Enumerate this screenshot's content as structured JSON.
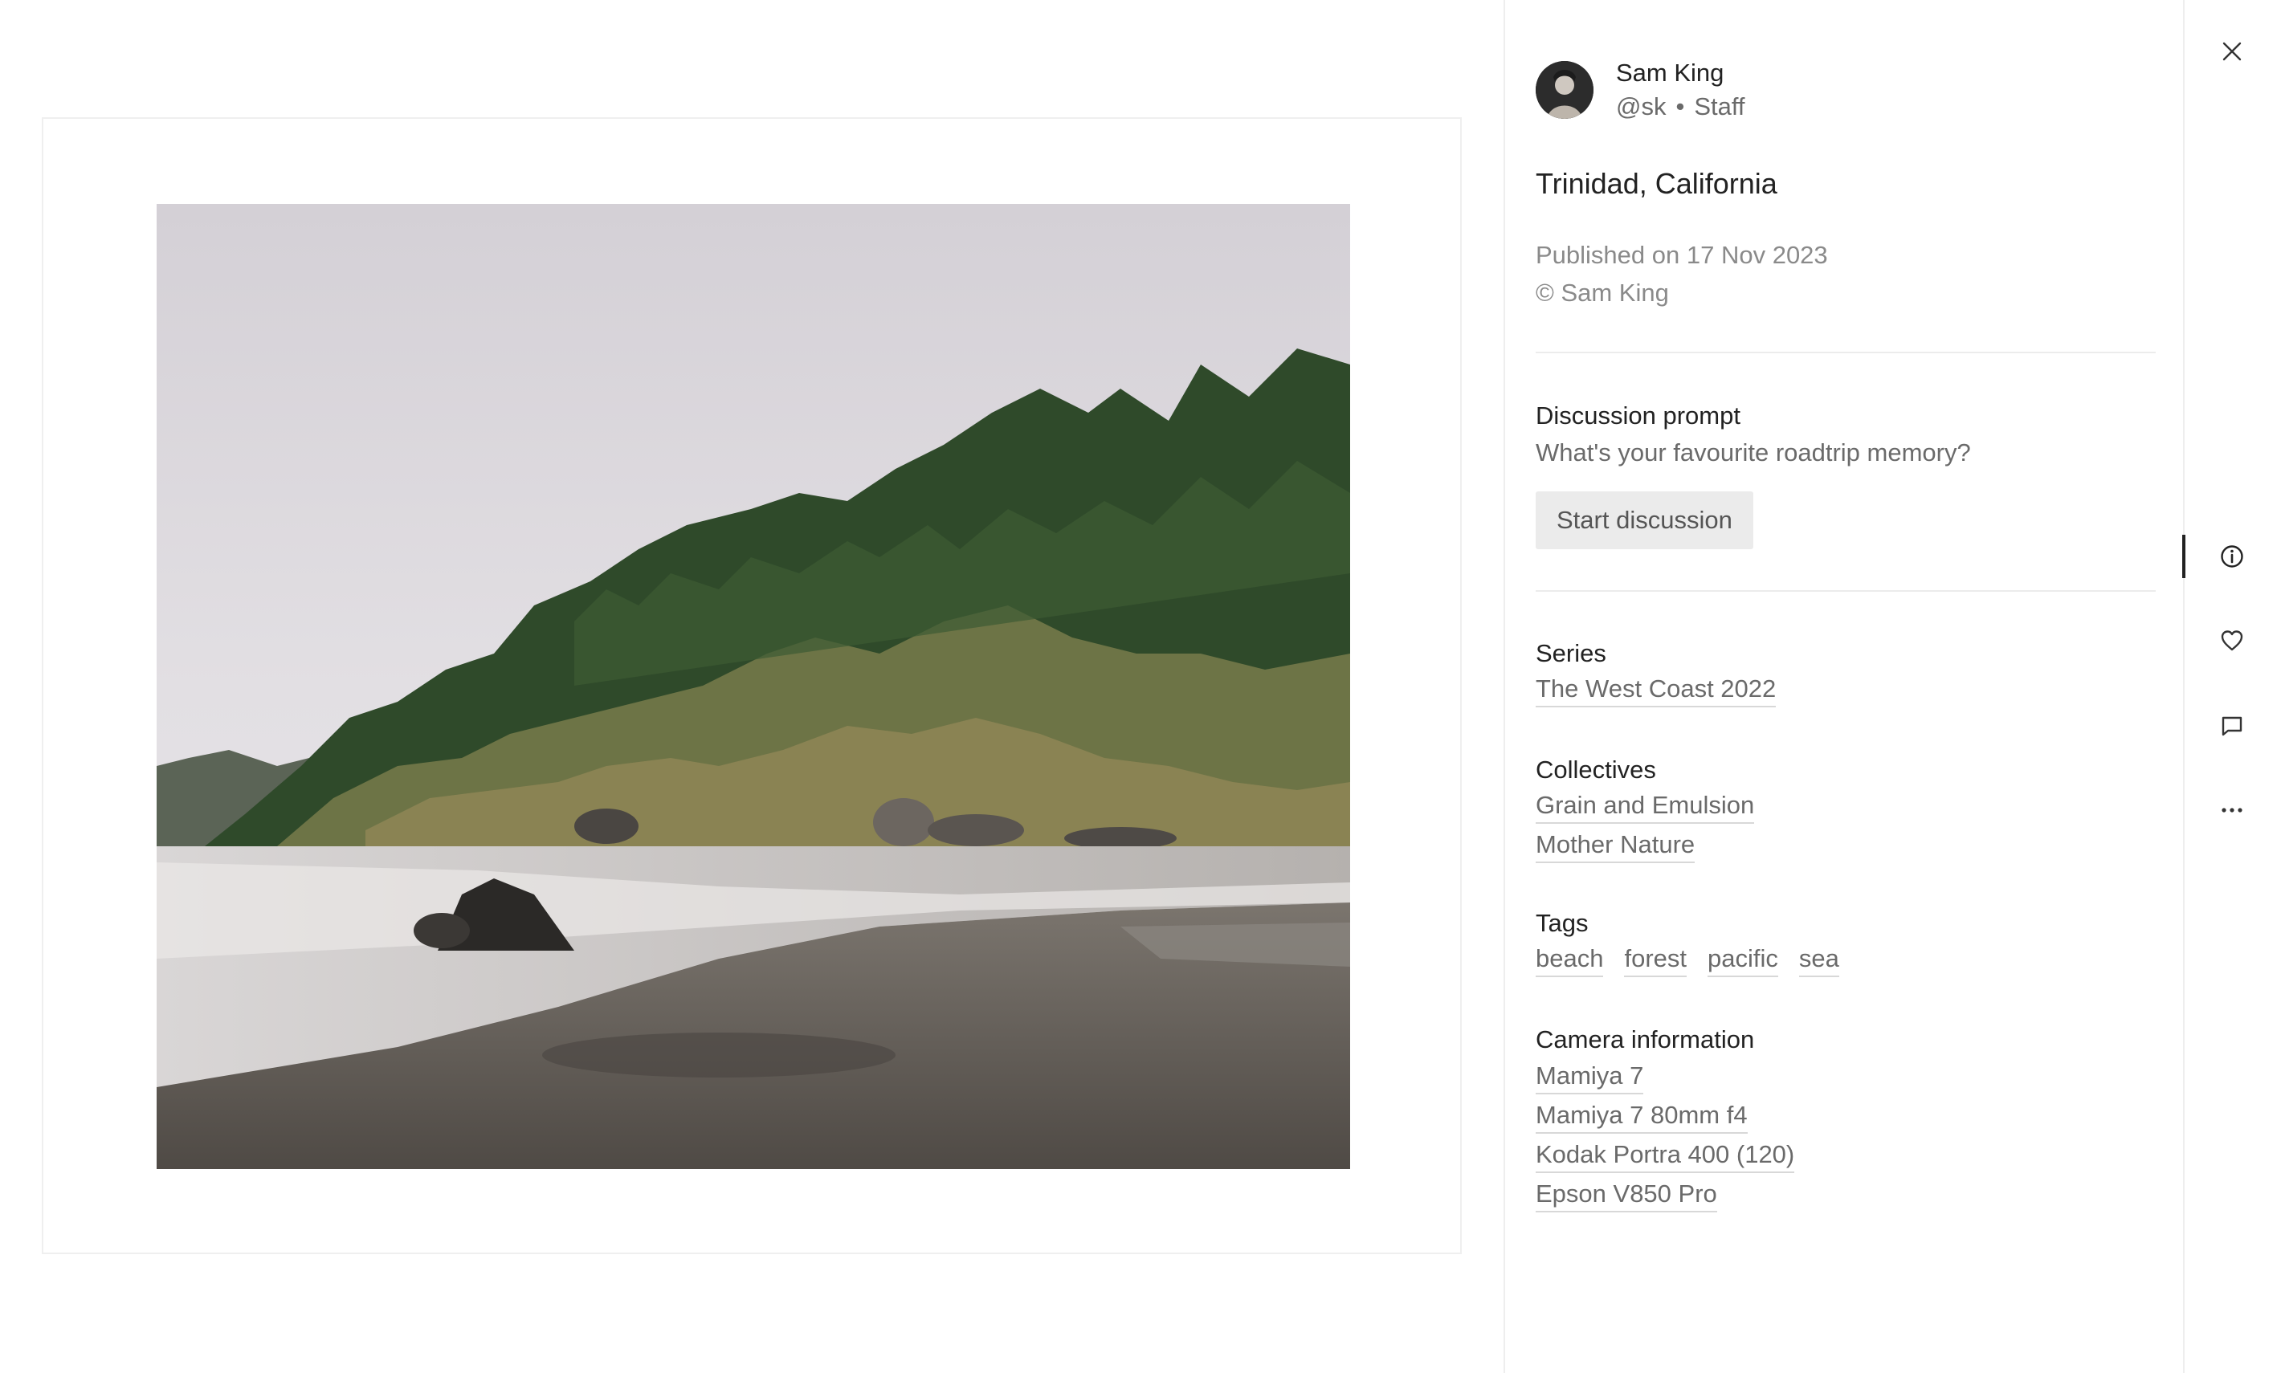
{
  "author": {
    "name": "Sam King",
    "handle": "@sk",
    "separator": "•",
    "role": "Staff"
  },
  "photo": {
    "title": "Trinidad, California",
    "published": "Published on 17 Nov 2023",
    "copyright": "© Sam King"
  },
  "discussion": {
    "label": "Discussion prompt",
    "prompt": "What's your favourite roadtrip memory?",
    "button_label": "Start discussion"
  },
  "series": {
    "label": "Series",
    "items": [
      "The West Coast 2022"
    ]
  },
  "collectives": {
    "label": "Collectives",
    "items": [
      "Grain and Emulsion",
      "Mother Nature"
    ]
  },
  "tags": {
    "label": "Tags",
    "items": [
      "beach",
      "forest",
      "pacific",
      "sea"
    ]
  },
  "camera": {
    "label": "Camera information",
    "items": [
      "Mamiya 7",
      "Mamiya 7 80mm f4",
      "Kodak Portra 400 (120)",
      "Epson V850 Pro"
    ]
  },
  "rail": {
    "close_icon": "close-icon",
    "info_icon": "info-icon",
    "like_icon": "heart-icon",
    "comment_icon": "comment-icon",
    "more_icon": "more-icon",
    "active": "info"
  },
  "colors": {
    "text_primary": "#222222",
    "text_secondary": "#6a6a6a",
    "text_muted": "#8a8a8a",
    "button_bg": "#ebebeb",
    "divider": "#ececec"
  }
}
